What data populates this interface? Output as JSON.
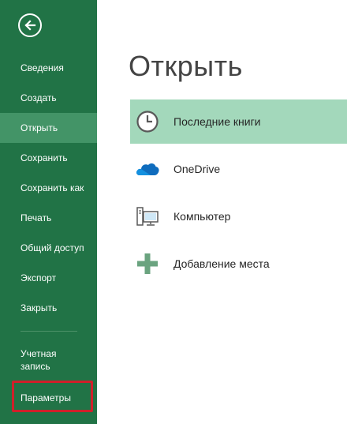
{
  "sidebar": {
    "back_icon": "back-arrow-icon",
    "items": [
      {
        "label": "Сведения"
      },
      {
        "label": "Создать"
      },
      {
        "label": "Открыть",
        "active": true
      },
      {
        "label": "Сохранить"
      },
      {
        "label": "Сохранить как"
      },
      {
        "label": "Печать"
      },
      {
        "label": "Общий доступ"
      },
      {
        "label": "Экспорт"
      },
      {
        "label": "Закрыть"
      }
    ],
    "account": {
      "line1": "Учетная",
      "line2": "запись"
    },
    "options": {
      "label": "Параметры",
      "highlighted": true
    }
  },
  "main": {
    "title": "Открыть",
    "locations": [
      {
        "label": "Последние книги",
        "icon": "clock-icon",
        "active": true
      },
      {
        "label": "OneDrive",
        "icon": "cloud-icon"
      },
      {
        "label": "Компьютер",
        "icon": "computer-icon"
      },
      {
        "label": "Добавление места",
        "icon": "plus-icon"
      }
    ]
  },
  "colors": {
    "sidebar_bg": "#217346",
    "sidebar_active": "#439467",
    "location_active": "#a3d8bb",
    "highlight_border": "#d0202a",
    "onedrive_blue": "#0f6cbd"
  }
}
